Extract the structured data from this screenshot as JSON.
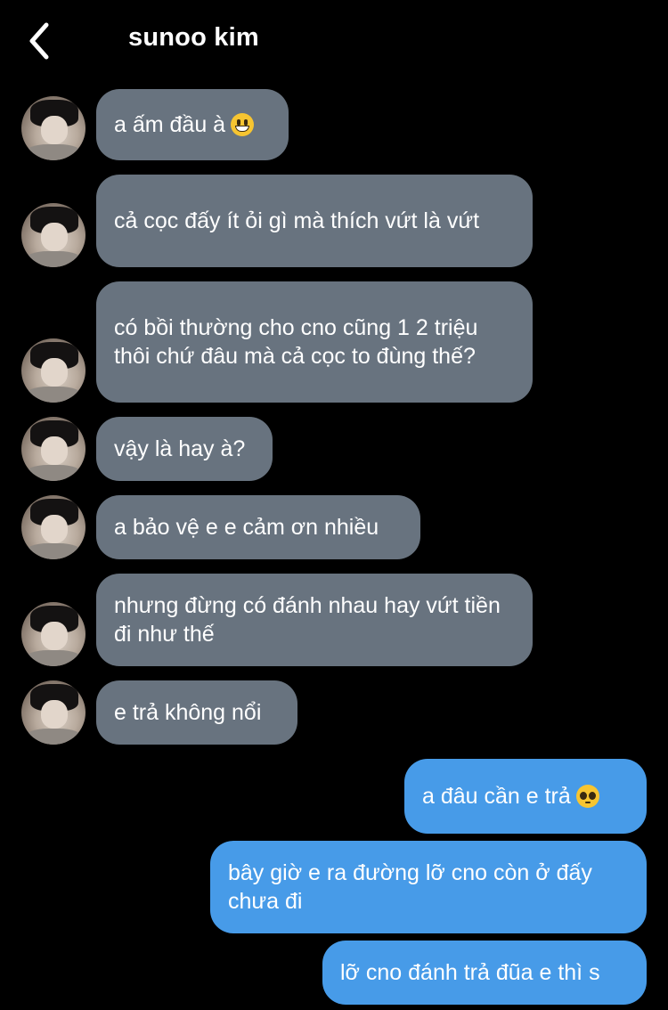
{
  "header": {
    "back_icon": "chevron-left-icon",
    "title": "sunoo kim"
  },
  "messages": [
    {
      "direction": "in",
      "text": "a ấm đầu à",
      "emoji": "smile-emoji"
    },
    {
      "direction": "in",
      "text": "cả cọc đấy ít ỏi gì mà thích vứt là vứt"
    },
    {
      "direction": "in",
      "text": "có bồi thường cho cno cũng 1 2 triệu thôi chứ đâu mà cả cọc to đùng thế?"
    },
    {
      "direction": "in",
      "text": "vậy là hay à?"
    },
    {
      "direction": "in",
      "text": "a bảo vệ e e cảm ơn nhiều"
    },
    {
      "direction": "in",
      "text": "nhưng đừng có đánh nhau hay vứt tiền đi như thế"
    },
    {
      "direction": "in",
      "text": "e trả không nổi"
    },
    {
      "direction": "out",
      "text": "a đâu cần e trả",
      "emoji": "pleading-face-emoji"
    },
    {
      "direction": "out",
      "text": "bây giờ e ra đường lỡ cno còn ở đấy chưa đi"
    },
    {
      "direction": "out",
      "text": "lỡ cno đánh trả đũa e thì s"
    }
  ],
  "colors": {
    "background": "#000000",
    "incoming_bubble": "#68737f",
    "outgoing_bubble": "#479be8",
    "text": "#ffffff"
  }
}
